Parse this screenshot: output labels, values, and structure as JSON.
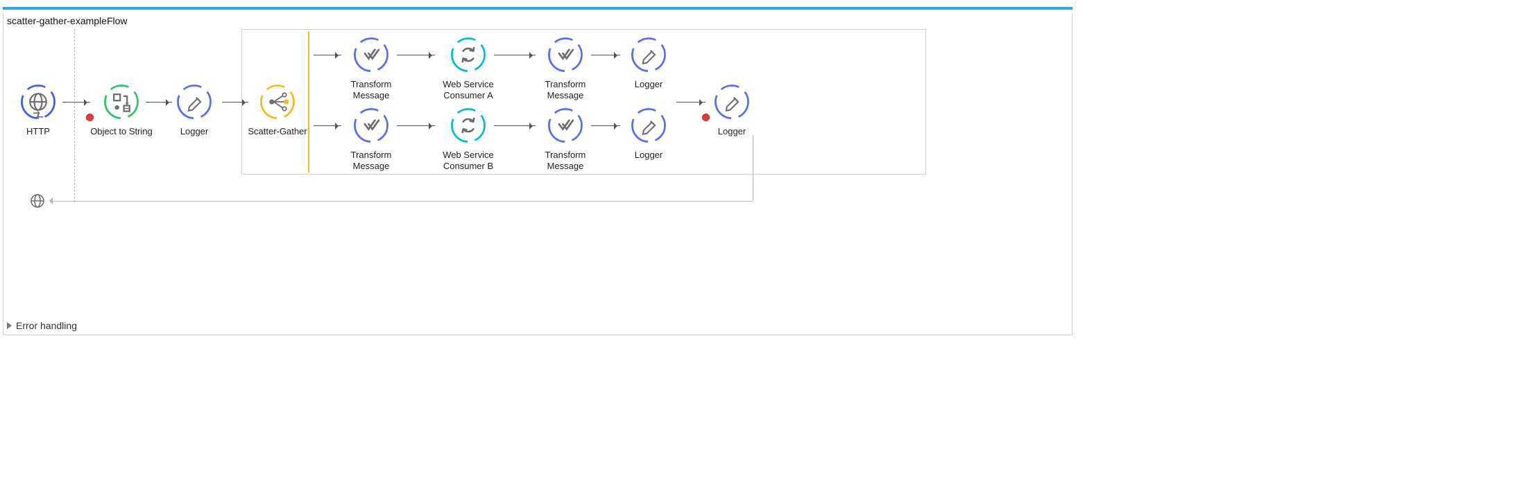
{
  "flow": {
    "title": "scatter-gather-exampleFlow",
    "error_handling_label": "Error handling"
  },
  "nodes": {
    "http": "HTTP",
    "object_to_string": "Object to String",
    "logger1": "Logger",
    "scatter_gather": "Scatter-Gather",
    "route_a": {
      "transform1": "Transform Message",
      "wsc": "Web Service Consumer A",
      "transform2": "Transform Message",
      "logger": "Logger"
    },
    "route_b": {
      "transform1": "Transform Message",
      "wsc": "Web Service Consumer B",
      "transform2": "Transform Message",
      "logger": "Logger"
    },
    "logger_final": "Logger"
  },
  "colors": {
    "http_ring": "#3d5afe",
    "logger_ring": "#536dfe",
    "ots_ring": "#2cc36b",
    "scatter_ring": "#f4bb1e",
    "wsc_ring": "#00bcd4",
    "icon_gray": "#6e6e6e"
  }
}
